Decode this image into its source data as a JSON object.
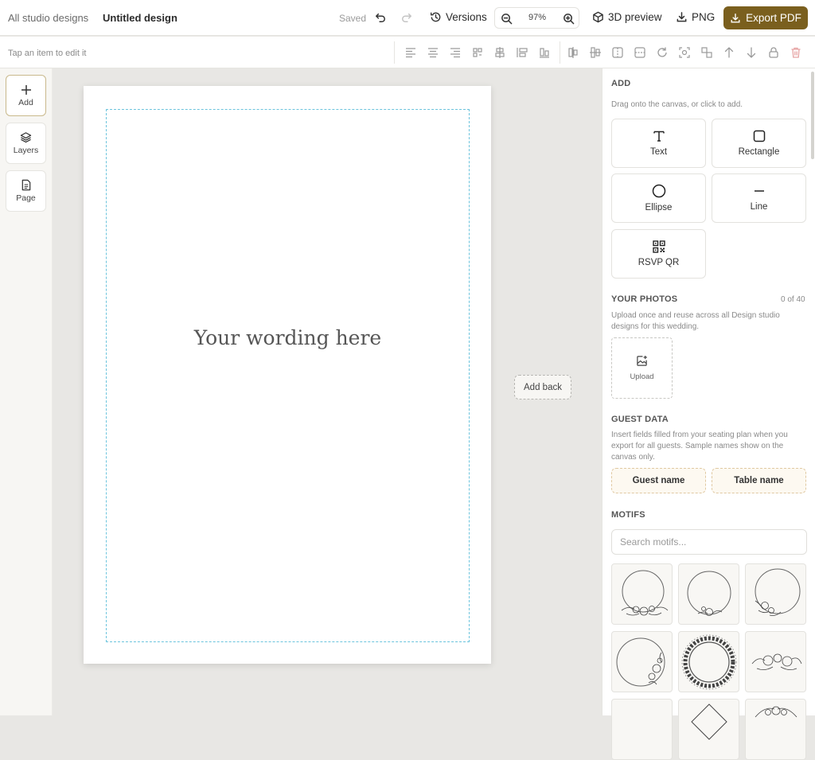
{
  "topbar": {
    "breadcrumb": "All studio designs",
    "title": "Untitled design",
    "saved": "Saved",
    "versions": "Versions",
    "zoom": "97%",
    "preview3d": "3D preview",
    "png": "PNG",
    "export_pdf": "Export PDF"
  },
  "toolbar": {
    "hint": "Tap an item to edit it",
    "icons": [
      "align-left-icon",
      "align-center-icon",
      "align-right-icon",
      "align-h-left-icon",
      "align-h-center-icon",
      "distribute-h-icon",
      "align-bottom-icon",
      "align-top-icon",
      "align-v-center-icon",
      "flip-h-icon",
      "flip-v-icon",
      "rotate-icon",
      "center-on-page-icon",
      "group-icon",
      "bring-forward-icon",
      "send-backward-icon",
      "lock-icon",
      "delete-icon"
    ]
  },
  "rail": {
    "add": "Add",
    "layers": "Layers",
    "page": "Page"
  },
  "canvas": {
    "wording": "Your wording here",
    "add_back": "Add back"
  },
  "panel": {
    "add": {
      "heading": "ADD",
      "desc": "Drag onto the canvas, or click to add.",
      "text": "Text",
      "rectangle": "Rectangle",
      "ellipse": "Ellipse",
      "line": "Line",
      "rsvp_qr": "RSVP QR"
    },
    "photos": {
      "heading": "YOUR PHOTOS",
      "count": "0 of 40",
      "desc": "Upload once and reuse across all Design studio designs for this wedding.",
      "upload": "Upload"
    },
    "guest": {
      "heading": "GUEST DATA",
      "desc": "Insert fields filled from your seating plan when you export for all guests. Sample names show on the canvas only.",
      "guest_name": "Guest name",
      "table_name": "Table name"
    },
    "motifs": {
      "heading": "MOTIFS",
      "search_placeholder": "Search motifs..."
    }
  },
  "colors": {
    "accent": "#7a5f1e",
    "guide": "#6cc4dd",
    "canvas_bg": "#e8e7e4"
  }
}
